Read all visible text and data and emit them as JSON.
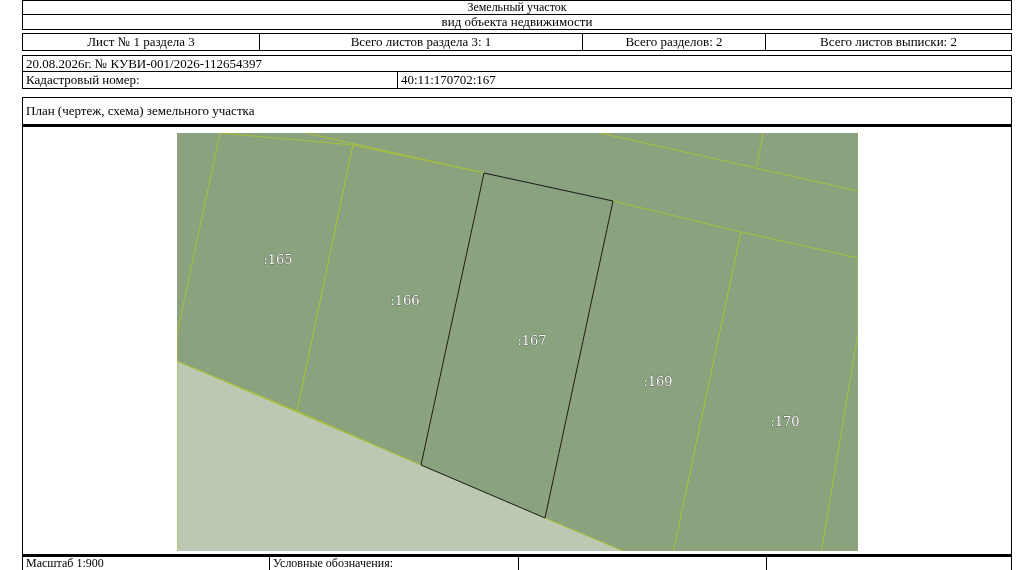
{
  "header": {
    "object_type": "Земельный участок",
    "object_type_caption": "вид объекта недвижимости"
  },
  "sheet_info": [
    "Лист № 1 раздела 3",
    "Всего листов раздела 3: 1",
    "Всего разделов: 2",
    "Всего листов выписки: 2"
  ],
  "extract_number": "20.08.2026г. № КУВИ-001/2026-112654397",
  "cadastral_number": {
    "label": "Кадастровый номер:",
    "value": "40:11:170702:167"
  },
  "plan": {
    "title": "План (чертеж, схема) земельного участка",
    "parcels": [
      {
        "label": ":165",
        "selected": false
      },
      {
        "label": ":166",
        "selected": false
      },
      {
        "label": ":167",
        "selected": true
      },
      {
        "label": ":169",
        "selected": false
      },
      {
        "label": ":170",
        "selected": false
      }
    ]
  },
  "footer": {
    "scale": "Масштаб 1:900",
    "legend_label": "Условные обозначения:"
  }
}
